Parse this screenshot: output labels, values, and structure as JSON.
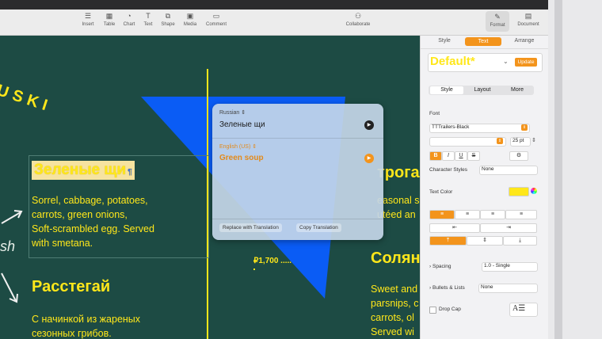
{
  "toolbar": {
    "items": [
      {
        "label": "Insert",
        "icon": "list-icon"
      },
      {
        "label": "Table",
        "icon": "table-icon"
      },
      {
        "label": "Chart",
        "icon": "chart-icon"
      },
      {
        "label": "Text",
        "icon": "text-icon"
      },
      {
        "label": "Shape",
        "icon": "shape-icon"
      },
      {
        "label": "Media",
        "icon": "media-icon"
      },
      {
        "label": "Comment",
        "icon": "comment-icon"
      }
    ],
    "collaborate": "Collaborate",
    "format": "Format",
    "document": "Document"
  },
  "canvas": {
    "curved_title": "USKI",
    "dish1_title": "Зеленые щи",
    "dish1_desc": [
      "Sorrel, cabbage, potatoes,",
      "carrots, green onions,",
      "Soft-scrambled egg. Served",
      "with smetana."
    ],
    "dish2_title": "Расстегай",
    "dish2_desc": [
      "С начинкой из жареных",
      "сезонных грибов."
    ],
    "right_title1": "трога",
    "right_desc1": [
      "easonal s",
      "utéed an"
    ],
    "right_title2": "Соляні",
    "right_desc2": [
      "Sweet and",
      "parsnips, c",
      "carrots, ol",
      "Served wi"
    ],
    "price": "₽1,700 .....",
    "script_text": "sh"
  },
  "translation": {
    "source_lang": "Russian",
    "source_text": "Зеленые щи",
    "target_lang": "English (US)",
    "target_text": "Green soup",
    "replace_button": "Replace with Translation",
    "copy_button": "Copy Translation"
  },
  "inspector": {
    "tabs": [
      "Style",
      "Text",
      "Arrange"
    ],
    "active_tab": "Text",
    "style_name": "Default*",
    "update_button": "Update",
    "subtabs": [
      "Style",
      "Layout",
      "More"
    ],
    "font_label": "Font",
    "font_name": "TTTrailers-Black",
    "font_size": "25 pt",
    "char_styles_label": "Character Styles",
    "char_styles_value": "None",
    "text_color_label": "Text Color",
    "text_color": "#ffe71a",
    "spacing_label": "Spacing",
    "spacing_value": "1.0 - Single",
    "bullets_label": "Bullets & Lists",
    "bullets_value": "None",
    "drop_cap_label": "Drop Cap",
    "bold": "B",
    "italic": "I",
    "underline": "U",
    "strike": "S"
  },
  "colors": {
    "canvas_bg": "#1d4b44",
    "accent_orange": "#f3941c",
    "blue_shape": "#0a5cf5",
    "yellow": "#ffe71a"
  }
}
